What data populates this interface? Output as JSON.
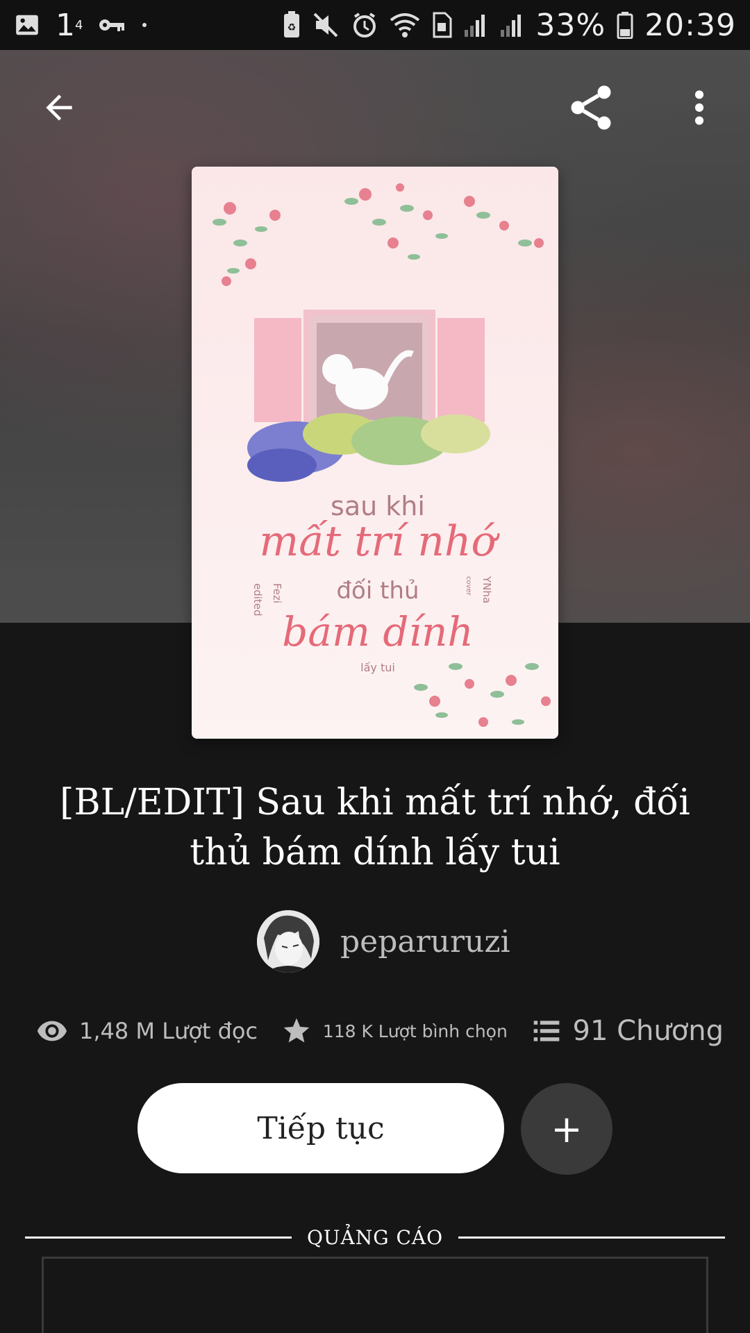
{
  "status_bar": {
    "notification_count": "1",
    "notification_sup": "4",
    "battery": "33%",
    "time": "20:39"
  },
  "book": {
    "title": "[BL/EDIT] Sau khi mất trí nhớ, đối thủ bám dính lấy tui",
    "author": "peparuruzi",
    "cover_art_text": {
      "line1": "sau khi",
      "line2": "mất trí nhớ",
      "line3": "đối thủ",
      "line4": "bám dính",
      "line5": "lấy tui",
      "side_left": "edited",
      "side_left2": "Fezi",
      "side_right": "YNha",
      "side_right2": "cover"
    }
  },
  "stats": {
    "reads": "1,48 M Lượt đọc",
    "votes": "118 K Lượt bình chọn",
    "chapters": "91 Chương"
  },
  "actions": {
    "continue_label": "Tiếp tục",
    "add_label": "+"
  },
  "ad": {
    "label": "QUẢNG CÁO"
  },
  "colors": {
    "background": "#161616",
    "hero_overlay": "#4f4f4f",
    "button_primary": "#ffffff",
    "button_secondary": "#3a3a3a",
    "muted_text": "#bdbdbd"
  }
}
